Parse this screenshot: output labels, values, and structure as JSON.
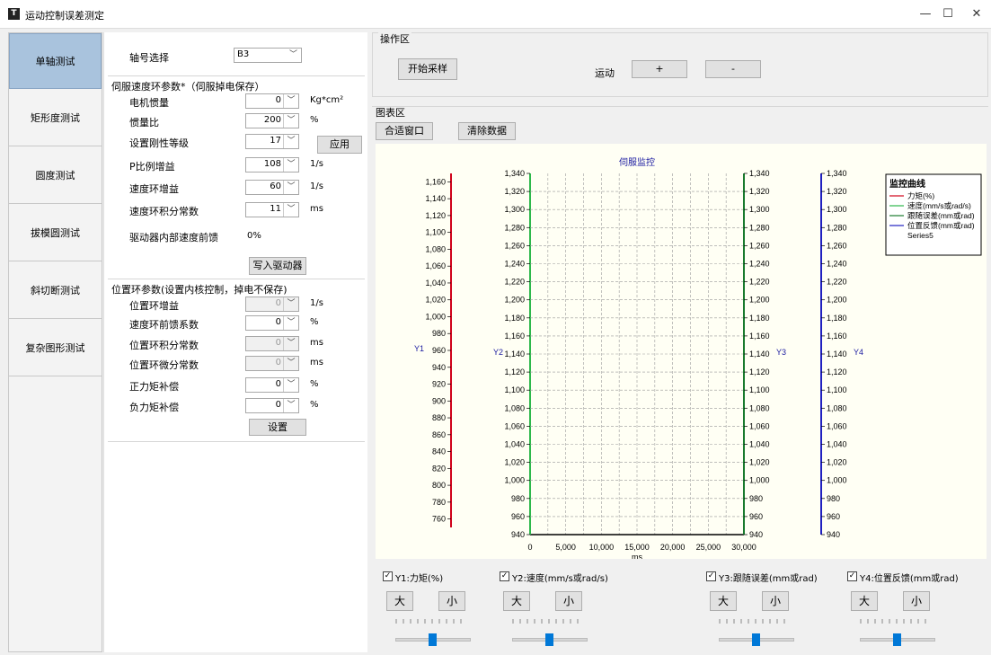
{
  "window": {
    "title": "运动控制误差测定",
    "minimize": "—",
    "maximize": "☐",
    "close": "✕"
  },
  "nav": [
    "单轴测试",
    "矩形度测试",
    "圆度测试",
    "拔模圆测试",
    "斜切断测试",
    "复杂图形测试"
  ],
  "axis": {
    "label": "轴号选择",
    "value": "B3"
  },
  "speed_group": {
    "title": "伺服速度环参数*（伺服掉电保存）",
    "rows": [
      {
        "label": "电机惯量",
        "value": "0",
        "unit": "Kg*cm²"
      },
      {
        "label": "惯量比",
        "value": "200",
        "unit": "%"
      },
      {
        "label": "设置刚性等级",
        "value": "17",
        "unit": ""
      },
      {
        "label": "P比例增益",
        "value": "108",
        "unit": "1/s"
      },
      {
        "label": "速度环增益",
        "value": "60",
        "unit": "1/s"
      },
      {
        "label": "速度环积分常数",
        "value": "11",
        "unit": "ms"
      }
    ],
    "apply": "应用",
    "ff_label": "驱动器内部速度前馈",
    "ff_value": "0%",
    "write": "写入驱动器"
  },
  "pos_group": {
    "title": "位置环参数(设置内核控制，掉电不保存)",
    "rows": [
      {
        "label": "位置环增益",
        "value": "0",
        "unit": "1/s",
        "disabled": true
      },
      {
        "label": "速度环前馈系数",
        "value": "0",
        "unit": "%",
        "disabled": false
      },
      {
        "label": "位置环积分常数",
        "value": "0",
        "unit": "ms",
        "disabled": true
      },
      {
        "label": "位置环微分常数",
        "value": "0",
        "unit": "ms",
        "disabled": true
      },
      {
        "label": "正力矩补偿",
        "value": "0",
        "unit": "%",
        "disabled": false
      },
      {
        "label": "负力矩补偿",
        "value": "0",
        "unit": "%",
        "disabled": false
      }
    ],
    "set": "设置"
  },
  "ops": {
    "title": "操作区",
    "start": "开始采样",
    "motion": "运动",
    "plus": "+",
    "minus": "-"
  },
  "chartpanel": {
    "title": "图表区",
    "fit": "合适窗口",
    "clear": "清除数据"
  },
  "chart_data": {
    "type": "line",
    "title": "伺服监控",
    "xlabel": "ms",
    "x_ticks": [
      "0",
      "5,000",
      "10,000",
      "15,000",
      "20,000",
      "25,000",
      "30,000"
    ],
    "xlim": [
      0,
      30000
    ],
    "axes": [
      {
        "name": "Y1",
        "color": "#d0021b",
        "ylim": [
          750,
          1170
        ],
        "ticks": [
          "1,160",
          "1,140",
          "1,120",
          "1,100",
          "1,080",
          "1,060",
          "1,040",
          "1,020",
          "1,000",
          "980",
          "960",
          "940",
          "920",
          "900",
          "880",
          "860",
          "840",
          "820",
          "800",
          "780",
          "760"
        ]
      },
      {
        "name": "Y2",
        "color": "#2db84b",
        "ylim": [
          940,
          1340
        ],
        "ticks": [
          "1,340",
          "1,320",
          "1,300",
          "1,280",
          "1,260",
          "1,240",
          "1,220",
          "1,200",
          "1,180",
          "1,160",
          "1,140",
          "1,120",
          "1,100",
          "1,080",
          "1,060",
          "1,040",
          "1,020",
          "1,000",
          "980",
          "960",
          "940"
        ]
      },
      {
        "name": "Y3",
        "color": "#1a7a2e",
        "ylim": [
          940,
          1340
        ],
        "ticks": [
          "1,340",
          "1,320",
          "1,300",
          "1,280",
          "1,260",
          "1,240",
          "1,220",
          "1,200",
          "1,180",
          "1,160",
          "1,140",
          "1,120",
          "1,100",
          "1,080",
          "1,060",
          "1,040",
          "1,020",
          "1,000",
          "980",
          "960",
          "940"
        ]
      },
      {
        "name": "Y4",
        "color": "#2020c0",
        "ylim": [
          940,
          1340
        ],
        "ticks": [
          "1,340",
          "1,320",
          "1,300",
          "1,280",
          "1,260",
          "1,240",
          "1,220",
          "1,200",
          "1,180",
          "1,160",
          "1,140",
          "1,120",
          "1,100",
          "1,080",
          "1,060",
          "1,040",
          "1,020",
          "1,000",
          "980",
          "960",
          "940"
        ]
      }
    ],
    "legend": {
      "title": "监控曲线",
      "placement": "top-right",
      "items": [
        {
          "name": "力矩(%)",
          "color": "#d0021b"
        },
        {
          "name": "速度(mm/s或rad/s)",
          "color": "#2db84b"
        },
        {
          "name": "跟随误差(mm或rad)",
          "color": "#1a7a2e"
        },
        {
          "name": "位置反馈(mm或rad)",
          "color": "#2020c0"
        },
        {
          "name": "Series5",
          "color": ""
        }
      ]
    },
    "grid": true
  },
  "controls": [
    {
      "label": "Y1:力矩(%)",
      "big": "大",
      "small": "小",
      "level": 0.5
    },
    {
      "label": "Y2:速度(mm/s或rad/s)",
      "big": "大",
      "small": "小",
      "level": 0.5
    },
    {
      "label": "Y3:跟随误差(mm或rad)",
      "big": "大",
      "small": "小",
      "level": 0.5
    },
    {
      "label": "Y4:位置反馈(mm或rad)",
      "big": "大",
      "small": "小",
      "level": 0.5
    }
  ]
}
